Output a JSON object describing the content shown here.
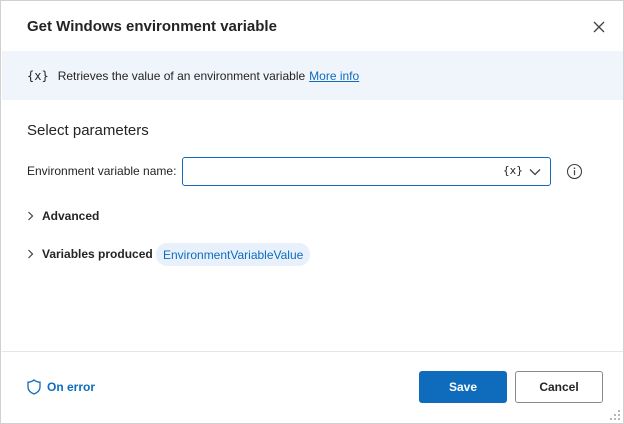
{
  "dialog": {
    "title": "Get Windows environment variable",
    "close_icon": "close-icon"
  },
  "info_bar": {
    "variable_glyph": "{x}",
    "description": "Retrieves the value of an environment variable",
    "link_text": "More info"
  },
  "parameters": {
    "section_title": "Select parameters",
    "env_var_label": "Environment variable name:",
    "env_var_value": "",
    "variable_picker_glyph": "{x}",
    "dropdown_icon": "chevron-down-icon",
    "info_icon": "info-icon"
  },
  "advanced": {
    "label": "Advanced"
  },
  "variables_produced": {
    "label": "Variables produced",
    "chip": "EnvironmentVariableValue"
  },
  "footer": {
    "on_error_label": "On error",
    "on_error_icon": "shield-icon",
    "save_label": "Save",
    "cancel_label": "Cancel"
  },
  "colors": {
    "accent": "#0f6cbd",
    "info_bar_bg": "#f0f5fc",
    "chip_bg": "#e8f0fb"
  }
}
